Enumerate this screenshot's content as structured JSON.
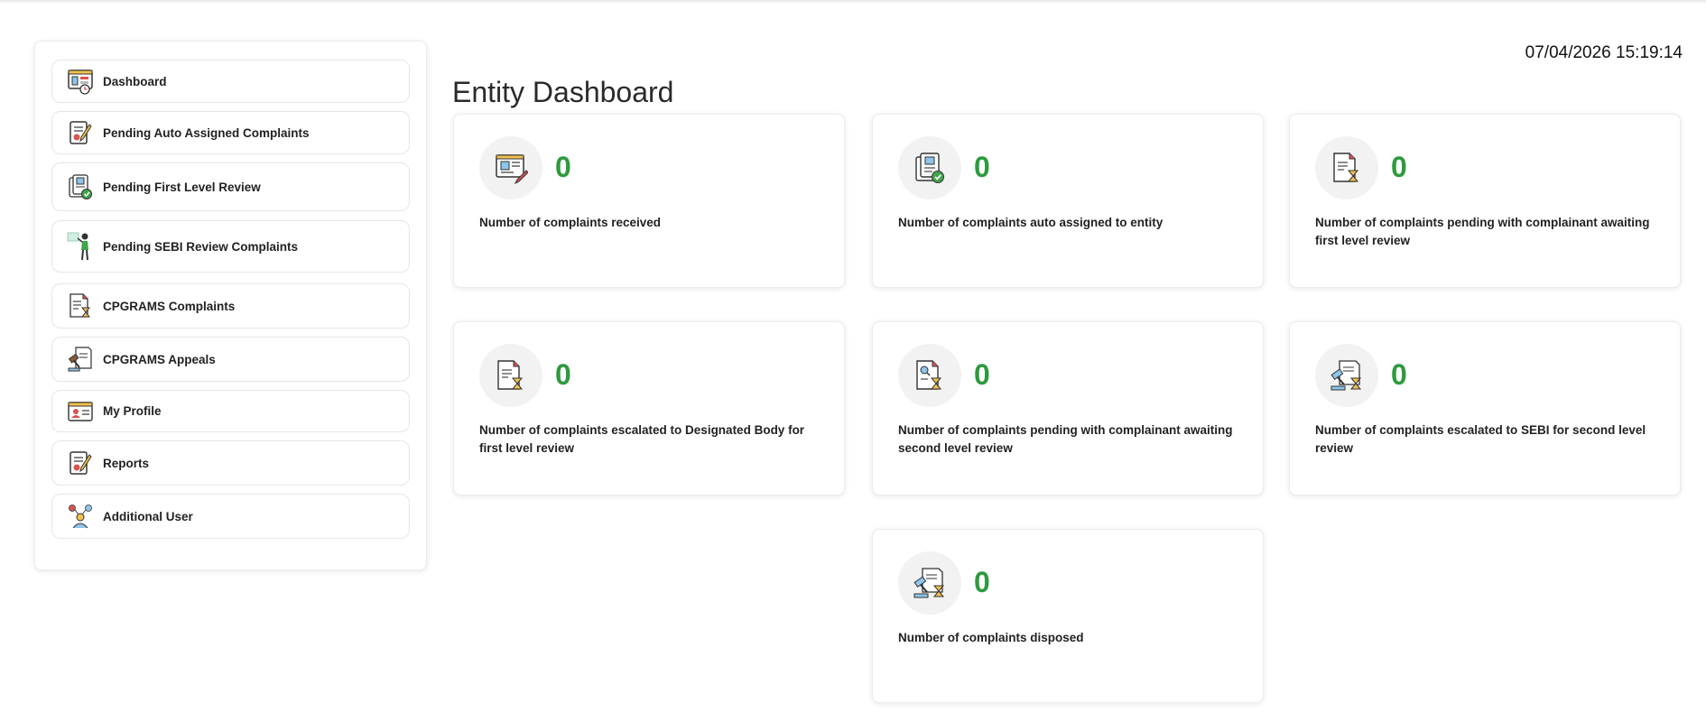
{
  "header": {
    "datetime": "07/04/2026 15:19:14",
    "title": "Entity Dashboard"
  },
  "sidebar": {
    "items": [
      {
        "label": "Dashboard",
        "icon": "dashboard-icon"
      },
      {
        "label": "Pending Auto Assigned Complaints",
        "icon": "document-pen-icon"
      },
      {
        "label": "Pending First Level Review",
        "icon": "document-check-icon"
      },
      {
        "label": "Pending SEBI Review Complaints",
        "icon": "presenter-icon"
      },
      {
        "label": "CPGRAMS Complaints",
        "icon": "document-hourglass-icon"
      },
      {
        "label": "CPGRAMS Appeals",
        "icon": "gavel-icon"
      },
      {
        "label": "My Profile",
        "icon": "id-card-icon"
      },
      {
        "label": "Reports",
        "icon": "report-icon"
      },
      {
        "label": "Additional User",
        "icon": "users-icon"
      }
    ]
  },
  "cards": [
    {
      "count": "0",
      "desc": "Number of complaints received",
      "icon": "complaint-form-icon"
    },
    {
      "count": "0",
      "desc": "Number of complaints auto assigned to entity",
      "icon": "document-check-icon"
    },
    {
      "count": "0",
      "desc": "Number of complaints pending with complainant awaiting first level review",
      "icon": "document-hourglass-icon"
    },
    {
      "count": "0",
      "desc": "Number of complaints escalated to Designated Body for first level review",
      "icon": "document-hourglass-icon"
    },
    {
      "count": "0",
      "desc": "Number of complaints pending with complainant awaiting second level review",
      "icon": "document-search-hourglass-icon"
    },
    {
      "count": "0",
      "desc": "Number of complaints escalated to SEBI for second level review",
      "icon": "gavel-hourglass-icon"
    },
    {
      "count": "0",
      "desc": "Number of complaints disposed",
      "icon": "gavel-hourglass-icon"
    }
  ],
  "colors": {
    "count_green": "#2e9a3e",
    "accent_red": "#d9534f"
  }
}
